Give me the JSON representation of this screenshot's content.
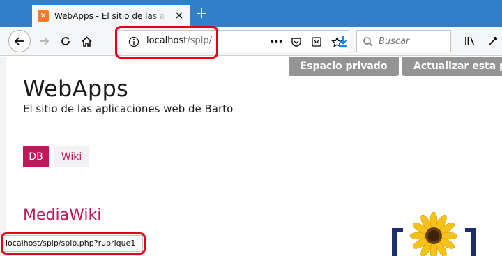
{
  "browser": {
    "tab_title": "WebApps - El sitio de las aplicaciones web de Barto",
    "url_host": "localhost",
    "url_path": "/spip/",
    "search_placeholder": "Buscar",
    "url_ellipsis": "•••",
    "status_url": "localhost/spip/spip.php?rubrique1"
  },
  "page": {
    "buttons": {
      "privado": "Espacio privado",
      "actualizar": "Actualizar esta página"
    },
    "title": "WebApps",
    "slogan": "El sitio de las aplicaciones web de Barto",
    "tags": [
      {
        "label": "DB"
      },
      {
        "label": "Wiki"
      }
    ],
    "section_title": "MediaWiki"
  },
  "colors": {
    "accent": "#c2185b",
    "highlight": "#e4001a",
    "button_grey": "#949494"
  }
}
